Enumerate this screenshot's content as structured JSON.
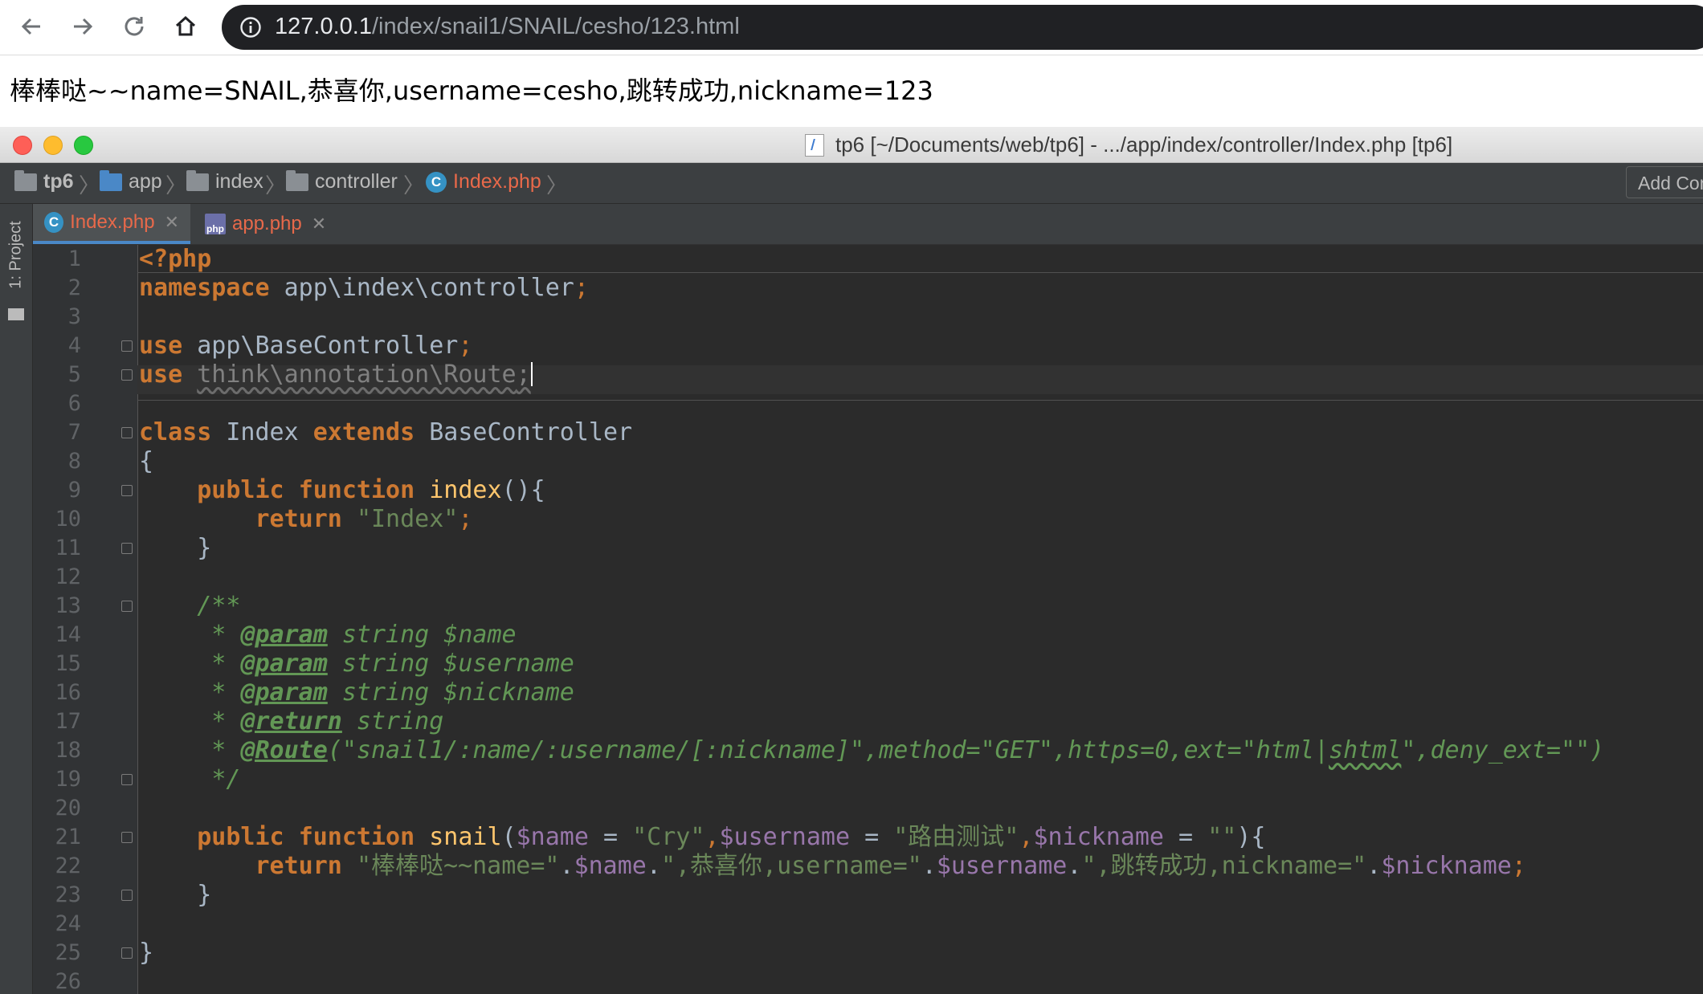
{
  "browser": {
    "back_icon": "arrow-left-icon",
    "forward_icon": "arrow-right-icon",
    "reload_icon": "reload-icon",
    "home_icon": "home-icon",
    "url_host": "127.0.0.1",
    "url_path": "/index/snail1/SNAIL/cesho/123.html"
  },
  "page": {
    "text": "棒棒哒~~name=SNAIL,恭喜你,username=cesho,跳转成功,nickname=123"
  },
  "ide": {
    "window_title": "tp6 [~/Documents/web/tp6] - .../app/index/controller/Index.php [tp6]",
    "breadcrumb": [
      "tp6",
      "app",
      "index",
      "controller",
      "Index.php"
    ],
    "add_config_label": "Add Con",
    "side_tab_label": "1: Project",
    "tabs": [
      {
        "icon_text": "C",
        "label": "Index.php",
        "active": true
      },
      {
        "icon_text": "php",
        "label": "app.php",
        "active": false
      }
    ],
    "line_numbers": [
      "1",
      "2",
      "3",
      "4",
      "5",
      "6",
      "7",
      "8",
      "9",
      "10",
      "11",
      "12",
      "13",
      "14",
      "15",
      "16",
      "17",
      "18",
      "19",
      "20",
      "21",
      "22",
      "23",
      "24",
      "25",
      "26"
    ],
    "code": {
      "l1": "<?php",
      "l2_kw": "namespace",
      "l2_ns": " app\\index\\controller",
      "l4_kw": "use",
      "l4_ns": " app\\BaseController",
      "l5_kw": "use",
      "l5_ns": "think\\annotation\\Route",
      "l7_kw": "class",
      "l7_name": " Index ",
      "l7_ext": "extends",
      "l7_base": " BaseController",
      "l8": "{",
      "l9_kw1": "public",
      "l9_kw2": "function",
      "l9_fn": "index",
      "l9_rest": "(){",
      "l10_kw": "return",
      "l10_str": "\"Index\"",
      "l11": "}",
      "l13": "/**",
      "l14_tag": "@param",
      "l14_rest": " string $name",
      "l15_tag": "@param",
      "l15_rest": " string $username",
      "l16_tag": "@param",
      "l16_rest": " string $nickname",
      "l17_tag": "@return",
      "l17_rest": " string",
      "l18_tag": "@Route",
      "l18_rest1": "(\"snail1/:name/:username/[:nickname]\",method=\"GET\",https=0,ext=\"html|",
      "l18_wavy": "shtml",
      "l18_rest2": "\",deny_ext=\"\")",
      "l19": "*/",
      "l21_kw1": "public",
      "l21_kw2": "function",
      "l21_fn": "snail",
      "l21_v1": "$name",
      "l21_s1": "\"Cry\"",
      "l21_v2": "$username",
      "l21_s2": "\"路由测试\"",
      "l21_v3": "$nickname",
      "l21_s3": "\"\"",
      "l22_kw": "return",
      "l22_s1": "\"棒棒哒~~name=\"",
      "l22_v1": "$name",
      "l22_s2": "\",恭喜你,username=\"",
      "l22_v2": "$username",
      "l22_s3": "\",跳转成功,nickname=\"",
      "l22_v3": "$nickname",
      "l23": "}",
      "l25": "}"
    }
  }
}
